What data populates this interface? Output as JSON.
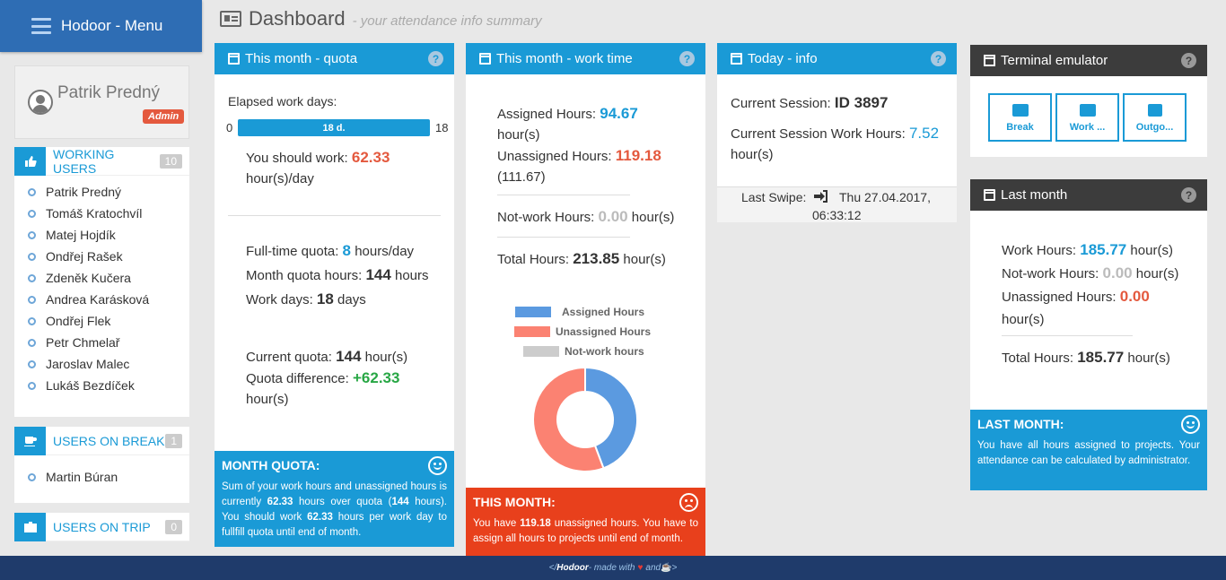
{
  "brand": {
    "title": "Hodoor - Menu"
  },
  "profile": {
    "name": "Patrik Predný",
    "role": "Admin"
  },
  "working_users": {
    "label": "WORKING USERS",
    "count": "10",
    "users": [
      "Patrik Predný",
      "Tomáš Kratochvíl",
      "Matej Hojdík",
      "Ondřej Rašek",
      "Zdeněk Kučera",
      "Andrea Karásková",
      "Ondřej Flek",
      "Petr Chmelař",
      "Jaroslav Malec",
      "Lukáš Bezdíček"
    ]
  },
  "users_on_break": {
    "label": "USERS ON BREAK",
    "count": "1",
    "users": [
      "Martin Búran"
    ]
  },
  "users_on_trip": {
    "label": "USERS ON TRIP",
    "count": "0"
  },
  "page": {
    "title": "Dashboard",
    "subtitle": "- your attendance info summary"
  },
  "quota": {
    "title": "This month - quota",
    "elapsed_label": "Elapsed work days:",
    "range_min": "0",
    "range_max": "18",
    "progress_label": "18 d.",
    "progress_fraction": 1.0,
    "should_work_label": "You should work:",
    "should_work_value": "62.33",
    "should_work_unit": "hour(s)/day",
    "fulltime_label": "Full-time quota:",
    "fulltime_value": "8",
    "fulltime_unit": "hours/day",
    "month_quota_label": "Month quota hours:",
    "month_quota_value": "144",
    "month_quota_unit": "hours",
    "work_days_label": "Work days:",
    "work_days_value": "18",
    "work_days_unit": "days",
    "current_quota_label": "Current quota:",
    "current_quota_value": "144",
    "current_quota_unit": "hour(s)",
    "diff_label": "Quota difference:",
    "diff_value": "+62.33",
    "diff_unit": "hour(s)",
    "note_title": "MONTH QUOTA:",
    "note_p1": "Sum of your work hours and unassigned hours is currently ",
    "note_v1": "62.33",
    "note_p2": " hours over quota (",
    "note_v2": "144",
    "note_p3": " hours). You should work ",
    "note_v3": "62.33",
    "note_p4": " hours per work day to fullfill quota until end of month."
  },
  "worktime": {
    "title": "This month - work time",
    "assigned_label": "Assigned Hours:",
    "assigned_value": "94.67",
    "assigned_unit": "hour(s)",
    "unassigned_label": "Unassigned Hours:",
    "unassigned_value": "119.18",
    "unassigned_sub": "(111.67)",
    "notwork_label": "Not-work Hours:",
    "notwork_value": "0.00",
    "notwork_unit": "hour(s)",
    "total_label": "Total Hours:",
    "total_value": "213.85",
    "total_unit": "hour(s)",
    "note_title": "THIS MONTH:",
    "note_p1": "You have ",
    "note_v1": "119.18",
    "note_p2": " unassigned hours. You have to assign all hours to projects until end of month."
  },
  "chart_data": {
    "type": "pie",
    "categories": [
      "Assigned Hours",
      "Unassigned Hours",
      "Not-work hours"
    ],
    "values": [
      94.67,
      119.18,
      0.0
    ],
    "colors": [
      "#5b9ae0",
      "#fb8272",
      "#cccccc"
    ],
    "legend": "top"
  },
  "today": {
    "title": "Today - info",
    "session_label": "Current Session:",
    "session_value": "ID 3897",
    "session_hours_label": "Current Session Work Hours:",
    "session_hours_value": "7.52",
    "session_hours_unit": "hour(s)",
    "swipe_label": "Last Swipe:",
    "swipe_value_1": "Thu 27.04.2017,",
    "swipe_value_2": "06:33:12"
  },
  "terminal": {
    "title": "Terminal emulator",
    "buttons": [
      "Break",
      "Work ...",
      "Outgo..."
    ]
  },
  "last_month": {
    "title": "Last month",
    "work_label": "Work Hours:",
    "work_value": "185.77",
    "work_unit": "hour(s)",
    "notwork_label": "Not-work Hours:",
    "notwork_value": "0.00",
    "notwork_unit": "hour(s)",
    "unassigned_label": "Unassigned Hours:",
    "unassigned_value": "0.00",
    "unassigned_unit": "hour(s)",
    "total_label": "Total Hours:",
    "total_value": "185.77",
    "total_unit": "hour(s)",
    "note_title": "LAST MONTH:",
    "note_text": "You have all hours assigned to projects. Your attendance can be calculated by administrator."
  },
  "footer": {
    "prefix": "</",
    "brand": "Hodoor",
    "made_with": " - made with ",
    "and": " and ",
    "suffix": " >"
  }
}
